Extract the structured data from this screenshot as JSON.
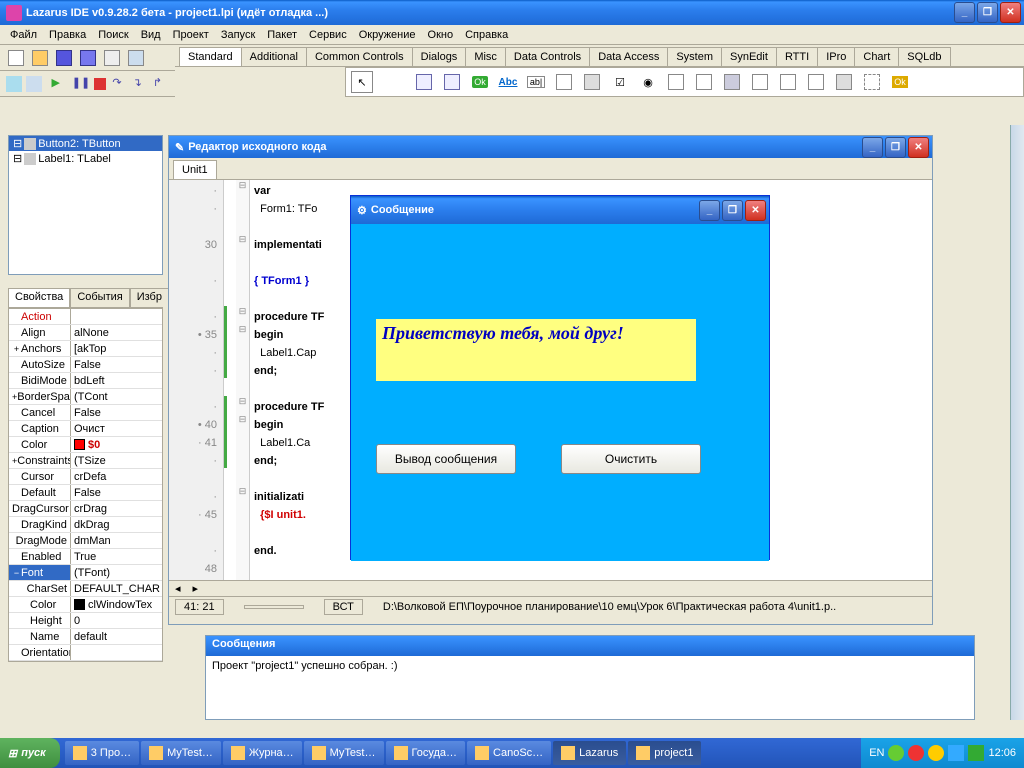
{
  "main_title": "Lazarus IDE v0.9.28.2 бета - project1.lpi (идёт отладка ...)",
  "menu": [
    "Файл",
    "Правка",
    "Поиск",
    "Вид",
    "Проект",
    "Запуск",
    "Пакет",
    "Сервис",
    "Окружение",
    "Окно",
    "Справка"
  ],
  "comp_tabs": [
    "Standard",
    "Additional",
    "Common Controls",
    "Dialogs",
    "Misc",
    "Data Controls",
    "Data Access",
    "System",
    "SynEdit",
    "RTTI",
    "IPro",
    "Chart",
    "SQLdb"
  ],
  "tree": {
    "n1": "Button2: TButton",
    "n2": "Label1: TLabel"
  },
  "props_tabs": [
    "Свойства",
    "События",
    "Избр"
  ],
  "props": [
    {
      "n": "Action",
      "v": "",
      "exp": "",
      "red": true
    },
    {
      "n": "Align",
      "v": "alNone",
      "exp": ""
    },
    {
      "n": "Anchors",
      "v": "[akTop",
      "exp": "+"
    },
    {
      "n": "AutoSize",
      "v": "False",
      "exp": ""
    },
    {
      "n": "BidiMode",
      "v": "bdLeft",
      "exp": ""
    },
    {
      "n": "BorderSpacing",
      "v": "(TCont",
      "exp": "+"
    },
    {
      "n": "Cancel",
      "v": "False",
      "exp": ""
    },
    {
      "n": "Caption",
      "v": "Очист",
      "exp": ""
    },
    {
      "n": "Color",
      "v": "$0",
      "exp": "",
      "color": "#f00"
    },
    {
      "n": "Constraints",
      "v": "(TSize",
      "exp": "+"
    },
    {
      "n": "Cursor",
      "v": "crDefa",
      "exp": ""
    },
    {
      "n": "Default",
      "v": "False",
      "exp": ""
    },
    {
      "n": "DragCursor",
      "v": "crDrag",
      "exp": ""
    },
    {
      "n": "DragKind",
      "v": "dkDrag",
      "exp": ""
    },
    {
      "n": "DragMode",
      "v": "dmMan",
      "exp": ""
    },
    {
      "n": "Enabled",
      "v": "True",
      "exp": ""
    },
    {
      "n": "Font",
      "v": "(TFont)",
      "exp": "−",
      "sel": true
    },
    {
      "n": "CharSet",
      "v": "DEFAULT_CHAR",
      "exp": "",
      "indent": true
    },
    {
      "n": "Color",
      "v": "clWindowTex",
      "exp": "",
      "indent": true,
      "color": "#000"
    },
    {
      "n": "Height",
      "v": "0",
      "exp": "",
      "indent": true
    },
    {
      "n": "Name",
      "v": "default",
      "exp": "",
      "indent": true
    },
    {
      "n": "Orientation",
      "v": "",
      "exp": "",
      "indent": true
    }
  ],
  "editor": {
    "title": "Редактор исходного кода",
    "tab": "Unit1",
    "code_lines": [
      {
        "ln": "",
        "mod": "",
        "dot": ".",
        "txt": "var",
        "cls": "kw"
      },
      {
        "ln": "",
        "mod": "",
        "dot": ".",
        "txt": "  Form1: TFo"
      },
      {
        "ln": "",
        "mod": "",
        "dot": "",
        "txt": ""
      },
      {
        "ln": "30",
        "mod": "",
        "dot": "",
        "txt": "implementati",
        "cls": "kw"
      },
      {
        "ln": "",
        "mod": "",
        "dot": "",
        "txt": ""
      },
      {
        "ln": "",
        "mod": "",
        "dot": ".",
        "txt": "{ TForm1 }",
        "cls": "cm"
      },
      {
        "ln": "",
        "mod": "",
        "dot": "",
        "txt": ""
      },
      {
        "ln": "",
        "mod": "m",
        "dot": ".",
        "txt": "procedure TF",
        "cls": "kw"
      },
      {
        "ln": "35",
        "mod": "m",
        "dot": "•",
        "txt": "begin",
        "cls": "kw"
      },
      {
        "ln": "",
        "mod": "m",
        "dot": ".",
        "txt": "  Label1.Cap"
      },
      {
        "ln": "",
        "mod": "m",
        "dot": ".",
        "txt": "end;",
        "cls": "kw"
      },
      {
        "ln": "",
        "mod": "",
        "dot": "",
        "txt": ""
      },
      {
        "ln": "",
        "mod": "m",
        "dot": ".",
        "txt": "procedure TF",
        "cls": "kw"
      },
      {
        "ln": "40",
        "mod": "m",
        "dot": "•",
        "txt": "begin",
        "cls": "kw"
      },
      {
        "ln": "41",
        "mod": "m",
        "dot": ".",
        "txt": "  Label1.Ca"
      },
      {
        "ln": "",
        "mod": "m",
        "dot": ".",
        "txt": "end;",
        "cls": "kw"
      },
      {
        "ln": "",
        "mod": "",
        "dot": "",
        "txt": ""
      },
      {
        "ln": "",
        "mod": "",
        "dot": ".",
        "txt": "initializati",
        "cls": "kw"
      },
      {
        "ln": "45",
        "mod": "",
        "dot": ".",
        "txt": "  {$I unit1.",
        "cls": "dir"
      },
      {
        "ln": "",
        "mod": "",
        "dot": "",
        "txt": ""
      },
      {
        "ln": "",
        "mod": "",
        "dot": ".",
        "txt": "end.",
        "cls": "kw"
      },
      {
        "ln": "48",
        "mod": "",
        "dot": "",
        "txt": ""
      }
    ],
    "status_pos": "41: 21",
    "status_mode": "ВСТ",
    "status_file": "D:\\Волковой ЕП\\Поурочное планирование\\10 емц\\Урок 6\\Практическая работа 4\\unit1.p.."
  },
  "form": {
    "title": "Сообщение",
    "label": "Приветствую тебя, мой друг!",
    "btn1": "Вывод сообщения",
    "btn2": "Очистить"
  },
  "msg": {
    "title": "Сообщения",
    "text": "Проект \"project1\" успешно собран. :)"
  },
  "taskbar": {
    "start": "пуск",
    "items": [
      "3 Про…",
      "MyTest…",
      "Журна…",
      "MyTest…",
      "Госуда…",
      "CanoSc…",
      "Lazarus",
      "project1"
    ],
    "lang": "EN",
    "clock": "12:06"
  }
}
